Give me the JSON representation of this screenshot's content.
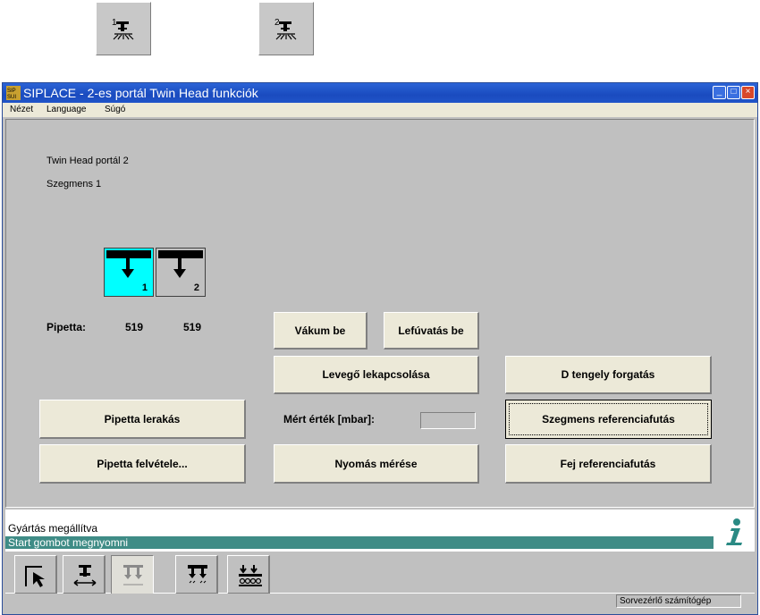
{
  "gantry_buttons": [
    {
      "label": "1",
      "icon": "gantry-1-icon"
    },
    {
      "label": "2",
      "icon": "gantry-2-icon"
    }
  ],
  "window": {
    "title": "SIPLACE - 2-es portál Twin Head funkciók",
    "icon": "siplace-app-icon",
    "controls": {
      "minimize": "_",
      "maximize": "□",
      "close": "×"
    }
  },
  "menu": [
    "Nézet",
    "Language",
    "Súgó"
  ],
  "panel": {
    "gantry_label": "Twin Head portál 2",
    "segment_label": "Szegmens 1",
    "pipettes": [
      {
        "number": "1",
        "value": "519",
        "selected": true,
        "color": "#00ffff"
      },
      {
        "number": "2",
        "value": "519",
        "selected": false,
        "color": "#c0c0c0"
      }
    ],
    "pipette_label": "Pipetta:",
    "measured_label": "Mért érték [mbar]:",
    "measured_value": "",
    "buttons": {
      "vacuum_on": "Vákum be",
      "blow_off_on": "Lefúvatás be",
      "air_off": "Levegő lekapcsolása",
      "d_axis_rotation": "D tengely forgatás",
      "pipette_deposit": "Pipetta lerakás",
      "segment_reference": "Szegmens referenciafutás",
      "pipette_pickup": "Pipetta felvétele...",
      "pressure_measure": "Nyomás mérése",
      "head_reference": "Fej referenciafutás"
    }
  },
  "status": {
    "line1": "Gyártás megállítva",
    "line2": "Start gombot megnyomni",
    "info_icon": "info-icon"
  },
  "toolbar": [
    {
      "name": "select-pointer-icon",
      "pressed": false
    },
    {
      "name": "head-move-icon",
      "pressed": false
    },
    {
      "name": "twin-head-disabled-icon",
      "pressed": true
    },
    {
      "name": "twin-head-icon",
      "pressed": false
    },
    {
      "name": "conveyor-heads-icon",
      "pressed": false
    }
  ],
  "statusbar": {
    "host": "Sorvezérlő számítógép"
  },
  "colors": {
    "title_bar": "#1a4bbf",
    "status_strip": "#3f8c86",
    "selected_pipette": "#00ffff",
    "button_face": "#ece9d8"
  }
}
